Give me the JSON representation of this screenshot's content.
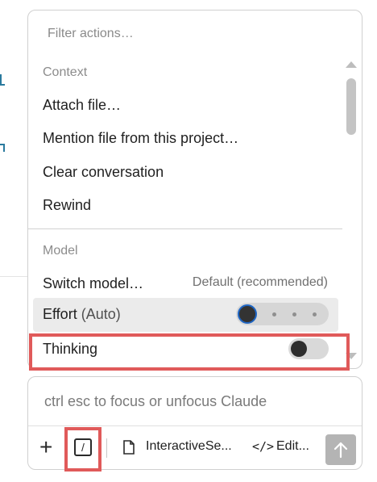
{
  "popup": {
    "filter_placeholder": "Filter actions…",
    "sections": [
      {
        "label": "Context",
        "items": [
          "Attach file…",
          "Mention file from this project…",
          "Clear conversation",
          "Rewind"
        ]
      },
      {
        "label": "Model",
        "items": [
          "Switch model…"
        ]
      }
    ],
    "switch_model_hint": "Default (recommended)",
    "effort": {
      "label": "Effort",
      "detail": "(Auto)",
      "level_index": 0,
      "levels": 4
    },
    "thinking": {
      "label": "Thinking",
      "enabled": false
    }
  },
  "input": {
    "placeholder": "ctrl esc to focus or unfocus Claude",
    "slash_glyph": "/",
    "file_chip": "InteractiveSe...",
    "edit_chip": "Edit...",
    "code_glyph": "</>"
  },
  "colors": {
    "highlight": "#e05a5a",
    "slider_focus": "#1f66c4",
    "send_button": "#b4b4b4"
  }
}
